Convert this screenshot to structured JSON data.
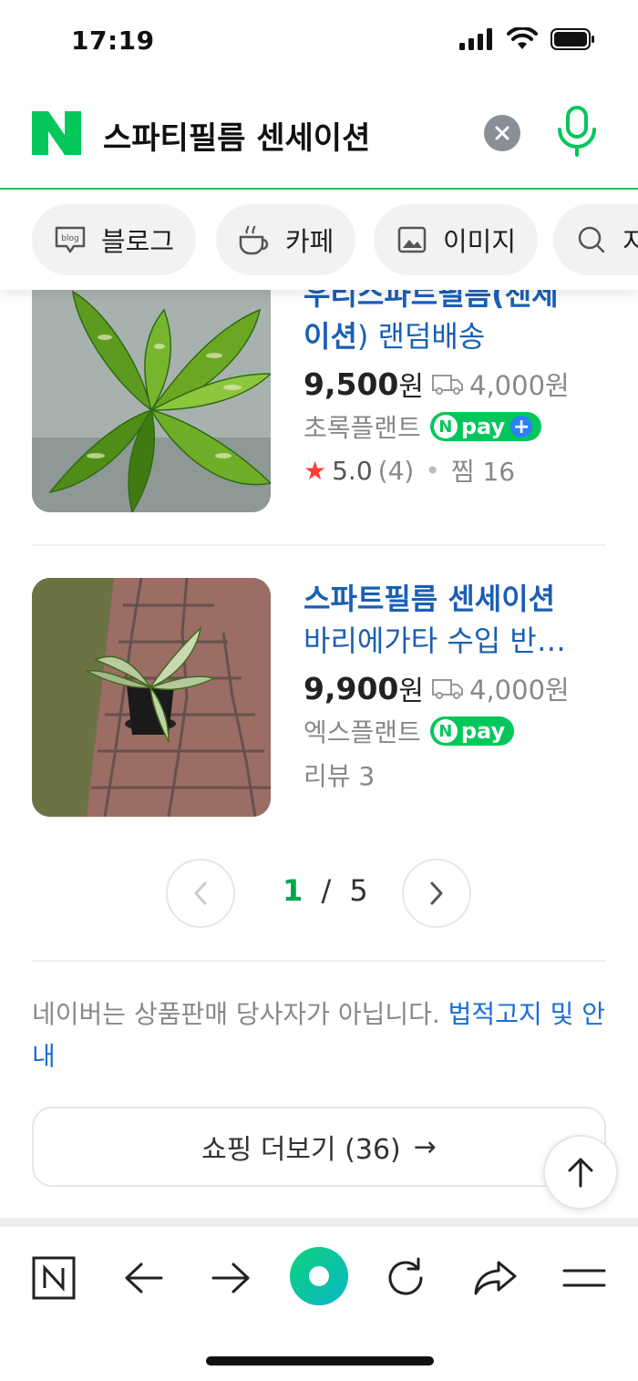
{
  "status_bar": {
    "time": "17:19"
  },
  "search": {
    "query": "스파티필름 센세이션"
  },
  "chips": [
    {
      "label": "블로그",
      "icon": "blog-icon"
    },
    {
      "label": "카페",
      "icon": "cafe-icon"
    },
    {
      "label": "이미지",
      "icon": "image-icon"
    },
    {
      "label": "지",
      "icon": "search-icon"
    }
  ],
  "products": [
    {
      "title_partial_line1": "우리스파트필름(센세",
      "title_line2_bold": "이션",
      "title_line2_rest": ") 랜덤배송",
      "price": "9,500",
      "won": "원",
      "shipping": "4,000원",
      "seller": "초록플랜트",
      "npay": "pay",
      "rating": "5.0",
      "rating_count": "(4)",
      "likes_label": "찜 16"
    },
    {
      "title_line1": "스파트필름 센세이션",
      "title_line2": "바리에가타 수입 반…",
      "price": "9,900",
      "won": "원",
      "shipping": "4,000원",
      "seller": "엑스플랜트",
      "npay": "pay",
      "review_label": "리뷰 3"
    }
  ],
  "pagination": {
    "current": "1",
    "separator": "/",
    "total": "5"
  },
  "notice": {
    "text": "네이버는 상품판매 당사자가 아닙니다. ",
    "link": "법적고지 및 안내"
  },
  "more_button": {
    "label": "쇼핑 더보기 (36)",
    "arrow": "→"
  },
  "colors": {
    "naver_green": "#03c75a",
    "link_blue": "#1a5fb4",
    "star_red": "#ff3b3b"
  }
}
